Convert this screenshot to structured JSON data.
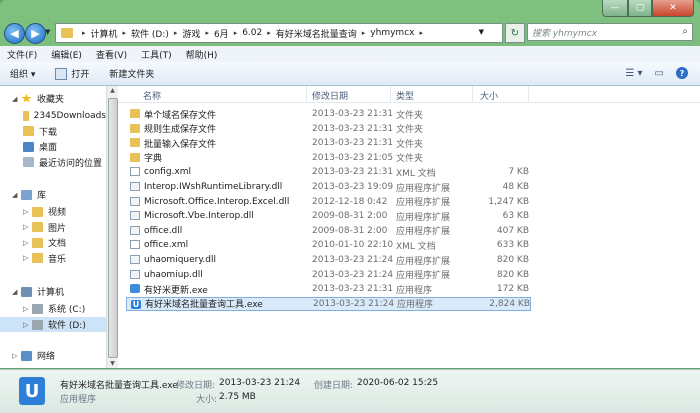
{
  "window": {
    "minimize": "—",
    "maximize": "▢",
    "close": "✕"
  },
  "nav": {
    "back": "◀",
    "forward": "▶"
  },
  "address": {
    "crumbs": [
      "计算机",
      "软件 (D:)",
      "游戏",
      "6月",
      "6.02",
      "有好米域名批量查询",
      "yhmymcx"
    ]
  },
  "search": {
    "placeholder": "搜索 yhmymcx"
  },
  "menu": [
    "文件(F)",
    "编辑(E)",
    "查看(V)",
    "工具(T)",
    "帮助(H)"
  ],
  "toolbar": {
    "organize": "组织 ▾",
    "open": "打开",
    "new_folder": "新建文件夹"
  },
  "sidebar": {
    "favorites": "收藏夹",
    "fav_items": [
      "2345Downloads",
      "下载",
      "桌面",
      "最近访问的位置"
    ],
    "libraries": "库",
    "lib_items": [
      "视频",
      "图片",
      "文档",
      "音乐"
    ],
    "computer": "计算机",
    "drives": [
      "系统 (C:)",
      "软件 (D:)"
    ],
    "network": "网络"
  },
  "columns": {
    "name": "名称",
    "date": "修改日期",
    "type": "类型",
    "size": "大小"
  },
  "files": [
    {
      "name": "单个域名保存文件",
      "date": "2013-03-23 21:31",
      "type": "文件夹",
      "size": "",
      "kind": "folder"
    },
    {
      "name": "规则生成保存文件",
      "date": "2013-03-23 21:31",
      "type": "文件夹",
      "size": "",
      "kind": "folder"
    },
    {
      "name": "批量输入保存文件",
      "date": "2013-03-23 21:31",
      "type": "文件夹",
      "size": "",
      "kind": "folder"
    },
    {
      "name": "字典",
      "date": "2013-03-23 21:05",
      "type": "文件夹",
      "size": "",
      "kind": "folder"
    },
    {
      "name": "config.xml",
      "date": "2013-03-23 21:31",
      "type": "XML 文档",
      "size": "7 KB",
      "kind": "xml"
    },
    {
      "name": "Interop.IWshRuntimeLibrary.dll",
      "date": "2013-03-23 19:09",
      "type": "应用程序扩展",
      "size": "48 KB",
      "kind": "dll"
    },
    {
      "name": "Microsoft.Office.Interop.Excel.dll",
      "date": "2012-12-18 0:42",
      "type": "应用程序扩展",
      "size": "1,247 KB",
      "kind": "dll"
    },
    {
      "name": "Microsoft.Vbe.Interop.dll",
      "date": "2009-08-31 2:00",
      "type": "应用程序扩展",
      "size": "63 KB",
      "kind": "dll"
    },
    {
      "name": "office.dll",
      "date": "2009-08-31 2:00",
      "type": "应用程序扩展",
      "size": "407 KB",
      "kind": "dll"
    },
    {
      "name": "office.xml",
      "date": "2010-01-10 22:10",
      "type": "XML 文档",
      "size": "633 KB",
      "kind": "xml"
    },
    {
      "name": "uhaomiquery.dll",
      "date": "2013-03-23 21:24",
      "type": "应用程序扩展",
      "size": "820 KB",
      "kind": "dll"
    },
    {
      "name": "uhaomiup.dll",
      "date": "2013-03-23 21:24",
      "type": "应用程序扩展",
      "size": "820 KB",
      "kind": "dll"
    },
    {
      "name": "有好米更新.exe",
      "date": "2013-03-23 21:31",
      "type": "应用程序",
      "size": "172 KB",
      "kind": "exe"
    },
    {
      "name": "有好米域名批量查询工具.exe",
      "date": "2013-03-23 21:24",
      "type": "应用程序",
      "size": "2,824 KB",
      "kind": "uexe",
      "selected": true
    }
  ],
  "details": {
    "icon_letter": "U",
    "filename": "有好米域名批量查询工具.exe",
    "mod_label": "修改日期:",
    "mod_value": "2013-03-23 21:24",
    "created_label": "创建日期:",
    "created_value": "2020-06-02 15:25",
    "type": "应用程序",
    "size_label": "大小:",
    "size_value": "2.75 MB"
  }
}
